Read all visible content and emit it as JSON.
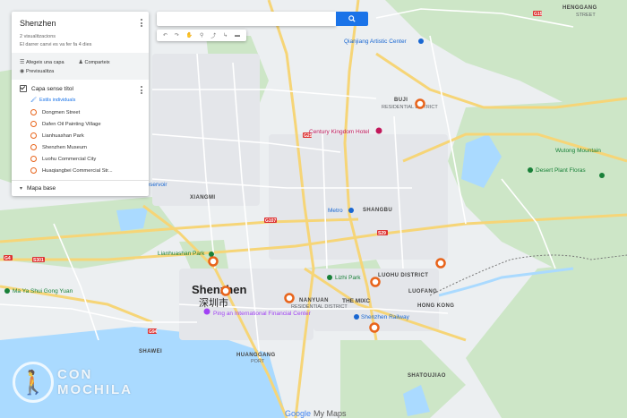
{
  "map": {
    "city_en": "Shenzhen",
    "city_cn": "深圳市",
    "footer_google": "Google",
    "footer_mymaps": "My Maps",
    "districts": [
      {
        "name": "HENGGANG",
        "sub": "STREET"
      },
      {
        "name": "BUJI",
        "sub": "RESIDENTIAL DISTRICT"
      },
      {
        "name": "LUOHU DISTRICT",
        "sub": ""
      },
      {
        "name": "HUANGGANG",
        "sub": "PORT"
      },
      {
        "name": "SHAWEI",
        "sub": ""
      },
      {
        "name": "NANYUAN",
        "sub": "RESIDENTIAL DISTRICT"
      },
      {
        "name": "XIANGMI",
        "sub": ""
      },
      {
        "name": "SHATOUJIAO",
        "sub": ""
      },
      {
        "name": "HONG KONG",
        "sub": ""
      },
      {
        "name": "LUOFANG",
        "sub": ""
      },
      {
        "name": "SHANGBU",
        "sub": ""
      }
    ],
    "pois": [
      {
        "name": "Century Kingdom Hotel",
        "color": "#c2185b"
      },
      {
        "name": "Ping an International Financial Center",
        "color": "#a142f4"
      },
      {
        "name": "Lianhuashan Park",
        "color": "#188038"
      },
      {
        "name": "Lizhi Park",
        "color": "#188038"
      },
      {
        "name": "Qianjiang Artistic Center",
        "color": "#1967d2"
      },
      {
        "name": "Shenzhen Railway",
        "color": "#1967d2"
      },
      {
        "name": "Desert Plant Floras",
        "color": "#188038"
      },
      {
        "name": "Wutong Mountain",
        "color": "#188038"
      },
      {
        "name": "Meilin Reservoir",
        "color": "#1967d2"
      },
      {
        "name": "Ma Ya Shui Gong Yuan",
        "color": "#188038"
      },
      {
        "name": "Metro",
        "color": "#1967d2"
      },
      {
        "name": "THE MIXC",
        "color": "#444444"
      }
    ],
    "roads": [
      "G4",
      "S29",
      "G107",
      "S301",
      "G94",
      "G15",
      "G25"
    ],
    "watermark": {
      "line1": "CON",
      "line2": "MOCHILA"
    }
  },
  "panel": {
    "title": "Shenzhen",
    "views": "2 visualitzacions",
    "updated": "El darrer canvi es va fer fa 4 dies",
    "add_layer": "Afegeix una capa",
    "share": "Comparteix",
    "preview": "Previsualitza",
    "layer_title": "Capa sense títol",
    "style_link": "Estils individuals",
    "items": [
      "Dongmen Street",
      "Dafen Oil Painting Village",
      "Lianhuashan Park",
      "Shenzhen Museum",
      "Luohu Commercial City",
      "Huaqiangbei Commercial Str..."
    ],
    "base_map": "Mapa base"
  },
  "colors": {
    "marker": "#e8641b",
    "accent": "#1a73e8",
    "park": "#c8e6c9",
    "water": "#aadaff",
    "highway": "#f6d577"
  }
}
